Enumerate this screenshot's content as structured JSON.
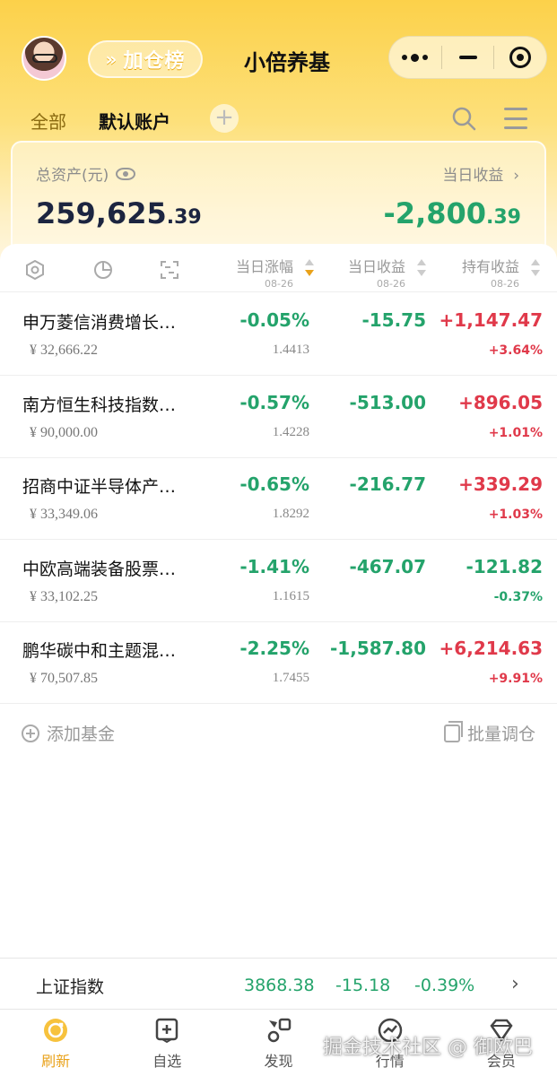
{
  "header": {
    "leaderboard_label": "加仓榜",
    "app_title": "小倍养基"
  },
  "tabs": {
    "all": "全部",
    "default_account": "默认账户"
  },
  "summary": {
    "total_assets_label": "总资产(元)",
    "total_assets_int": "259,625",
    "total_assets_dec": ".39",
    "daily_profit_label": "当日收益",
    "daily_profit_int": "-2,800",
    "daily_profit_dec": ".39"
  },
  "columns": {
    "daily_change": "当日涨幅",
    "daily_profit": "当日收益",
    "holding_profit": "持有收益",
    "date": "08-26"
  },
  "funds": [
    {
      "name": "申万菱信消费增长…",
      "amount": "¥ 32,666.22",
      "change": "-0.05%",
      "nav": "1.4413",
      "daily_profit": "-15.75",
      "holding_profit": "+1,147.47",
      "holding_pct": "+3.64%",
      "holding_up": true
    },
    {
      "name": "南方恒生科技指数…",
      "amount": "¥ 90,000.00",
      "change": "-0.57%",
      "nav": "1.4228",
      "daily_profit": "-513.00",
      "holding_profit": "+896.05",
      "holding_pct": "+1.01%",
      "holding_up": true
    },
    {
      "name": "招商中证半导体产…",
      "amount": "¥ 33,349.06",
      "change": "-0.65%",
      "nav": "1.8292",
      "daily_profit": "-216.77",
      "holding_profit": "+339.29",
      "holding_pct": "+1.03%",
      "holding_up": true
    },
    {
      "name": "中欧高端装备股票…",
      "amount": "¥ 33,102.25",
      "change": "-1.41%",
      "nav": "1.1615",
      "daily_profit": "-467.07",
      "holding_profit": "-121.82",
      "holding_pct": "-0.37%",
      "holding_up": false
    },
    {
      "name": "鹏华碳中和主题混…",
      "amount": "¥ 70,507.85",
      "change": "-2.25%",
      "nav": "1.7455",
      "daily_profit": "-1,587.80",
      "holding_profit": "+6,214.63",
      "holding_pct": "+9.91%",
      "holding_up": true
    }
  ],
  "actions": {
    "add_fund": "添加基金",
    "batch_adjust": "批量调仓"
  },
  "index": {
    "name": "上证指数",
    "value": "3868.38",
    "change": "-15.18",
    "pct": "-0.39%"
  },
  "nav_bar": {
    "items": [
      "刷新",
      "自选",
      "发现",
      "行情",
      "会员"
    ]
  },
  "watermark": "掘金技术社区 @ 御欧巴",
  "colors": {
    "accent": "#e9a21b",
    "green": "#24a36b",
    "red": "#e0394a"
  }
}
